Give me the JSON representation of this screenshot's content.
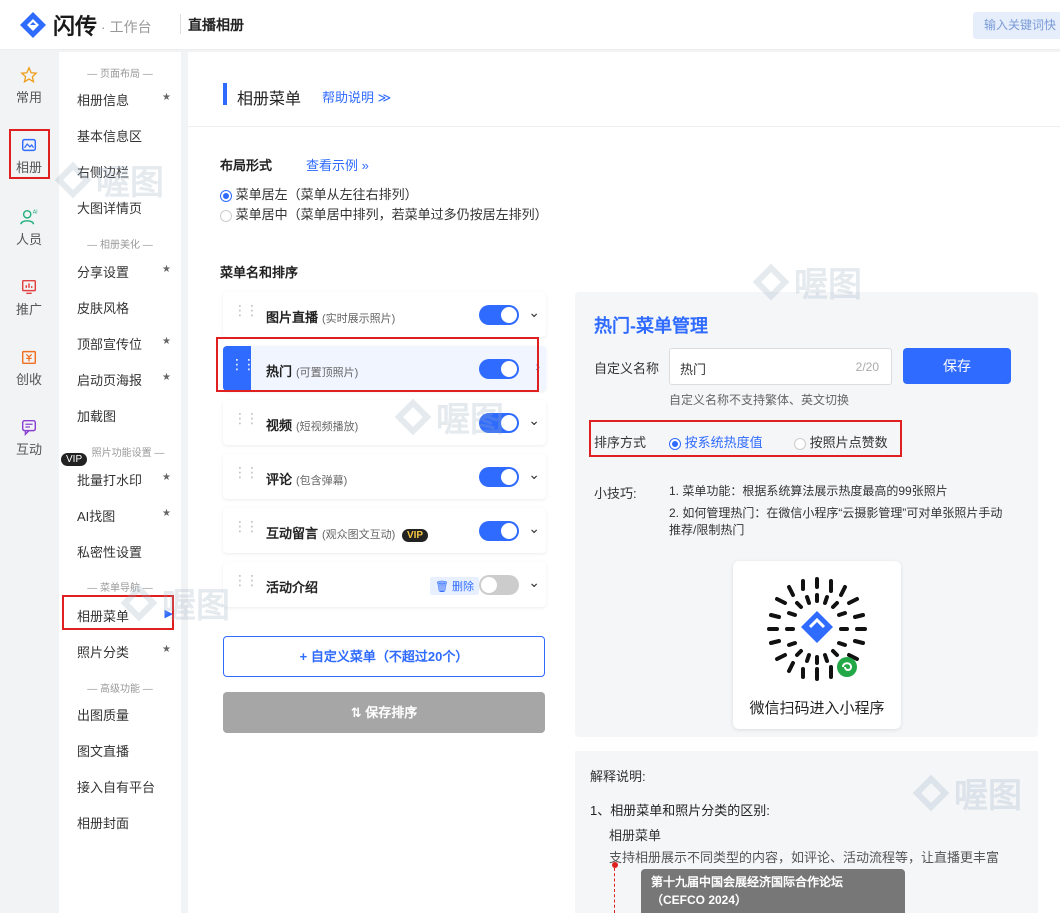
{
  "header": {
    "brand": "闪传",
    "brand_sub": "· 工作台",
    "page_title": "直播相册",
    "search_placeholder": "输入关键词快"
  },
  "rail": [
    {
      "label": "常用",
      "icon": "star-icon"
    },
    {
      "label": "相册",
      "icon": "album-icon"
    },
    {
      "label": "人员",
      "icon": "person-ai-icon"
    },
    {
      "label": "推广",
      "icon": "chart-icon"
    },
    {
      "label": "创收",
      "icon": "yen-icon"
    },
    {
      "label": "互动",
      "icon": "chat-icon"
    }
  ],
  "sidebar": {
    "sections": {
      "layout": "— 页面布局 —",
      "beautify": "— 相册美化 —",
      "photo_func": "照片功能设置 —",
      "menu_nav": "— 菜单导航 —",
      "advanced": "— 高级功能 —"
    },
    "vip_badge": "VIP",
    "star": "★",
    "arrow": "▶",
    "items": {
      "album_info": "相册信息",
      "basic_info": "基本信息区",
      "right_bar": "右侧边栏",
      "big_detail": "大图详情页",
      "share": "分享设置",
      "skin": "皮肤风格",
      "top_banner": "顶部宣传位",
      "poster": "启动页海报",
      "loading": "加载图",
      "watermark": "批量打水印",
      "ai_find": "AI找图",
      "privacy": "私密性设置",
      "album_menu": "相册菜单",
      "photo_cat": "照片分类",
      "quality": "出图质量",
      "text_live": "图文直播",
      "platform": "接入自有平台",
      "cover": "相册封面"
    }
  },
  "main": {
    "heading": "相册菜单",
    "help_link": "帮助说明 ≫",
    "layout_title": "布局形式",
    "view_example": "查看示例 »",
    "layout_left": "菜单居左（菜单从左往右排列）",
    "layout_center": "菜单居中（菜单居中排列，若菜单过多仍按居左排列）",
    "menu_section": "菜单名和排序",
    "menus": [
      {
        "name": "图片直播",
        "desc": "(实时展示照片)",
        "on": true
      },
      {
        "name": "热门",
        "desc": "(可置顶照片)",
        "on": true
      },
      {
        "name": "视频",
        "desc": "(短视频播放)",
        "on": true
      },
      {
        "name": "评论",
        "desc": "(包含弹幕)",
        "on": true
      },
      {
        "name": "互动留言",
        "desc": "(观众图文互动)",
        "on": true,
        "vip": "VIP"
      },
      {
        "name": "活动介绍",
        "desc": "",
        "on": false,
        "delete": "删除"
      }
    ],
    "custom_btn": "+ 自定义菜单（不超过20个）",
    "save_sort_btn": "⇅ 保存排序"
  },
  "panel": {
    "title": "热门-菜单管理",
    "name_label": "自定义名称",
    "name_value": "热门",
    "name_count": "2/20",
    "save": "保存",
    "name_hint": "自定义名称不支持繁体、英文切换",
    "sort_label": "排序方式",
    "sort_hot": "按系统热度值",
    "sort_likes": "按照片点赞数",
    "tips_label": "小技巧:",
    "tip1": "1. 菜单功能：根据系统算法展示热度最高的99张照片",
    "tip2": "2. 如何管理热门：在微信小程序“云摄影管理”可对单张照片手动推荐/限制热门",
    "qr_caption": "微信扫码进入小程序"
  },
  "explain": {
    "title": "解释说明:",
    "item1": "1、相册菜单和照片分类的区别:",
    "sub_title": "相册菜单",
    "sub_desc": "支持相册展示不同类型的内容，如评论、活动流程等，让直播更丰富",
    "card_line1": "第十九届中国会展经济国际合作论坛",
    "card_line2": "（CEFCO 2024）"
  },
  "watermark": "喔图",
  "colors": {
    "accent": "#2f6bff",
    "highlight": "#e02020"
  }
}
